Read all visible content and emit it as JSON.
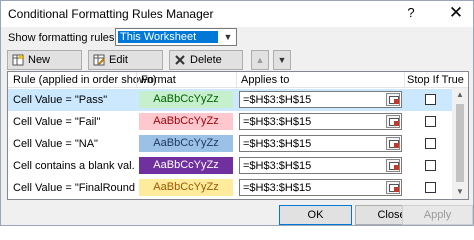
{
  "window": {
    "title": "Conditional Formatting Rules Manager",
    "help_glyph": "?",
    "close_glyph": "✕"
  },
  "show_rules": {
    "label": "Show formatting rules for:",
    "selected": "This Worksheet"
  },
  "toolbar": {
    "new_rule": "New Rule...",
    "edit_rule": "Edit Rule...",
    "delete_rule": "Delete Rule",
    "move_up_glyph": "▲",
    "move_down_glyph": "▼"
  },
  "columns": {
    "rule": "Rule (applied in order shown)",
    "format": "Format",
    "applies_to": "Applies to",
    "stop_if_true": "Stop If True"
  },
  "rules": [
    {
      "rule": "Cell Value = \"Pass\"",
      "format_preview": "AaBbCcYyZz",
      "fill": "#c6efce",
      "font_color": "#006100",
      "applies_to": "=$H$3:$H$15",
      "stop_if_true": false,
      "selected": true
    },
    {
      "rule": "Cell Value = \"Fail\"",
      "format_preview": "AaBbCcYyZz",
      "fill": "#ffc7ce",
      "font_color": "#9c0006",
      "applies_to": "=$H$3:$H$15",
      "stop_if_true": false,
      "selected": false
    },
    {
      "rule": "Cell Value = \"NA\"",
      "format_preview": "AaBbCcYyZz",
      "fill": "#9bc2e6",
      "font_color": "#1f3864",
      "applies_to": "=$H$3:$H$15",
      "stop_if_true": false,
      "selected": false
    },
    {
      "rule": "Cell contains a blank val...",
      "format_preview": "AaBbCcYyZz",
      "fill": "#7030a0",
      "font_color": "#ffffff",
      "applies_to": "=$H$3:$H$15",
      "stop_if_true": false,
      "selected": false
    },
    {
      "rule": "Cell Value = \"FinalRound\"",
      "format_preview": "AaBbCcYyZz",
      "fill": "#ffeb9c",
      "font_color": "#9c5700",
      "applies_to": "=$H$3:$H$15",
      "stop_if_true": false,
      "selected": false
    }
  ],
  "footer": {
    "ok": "OK",
    "close": "Close",
    "apply": "Apply"
  }
}
